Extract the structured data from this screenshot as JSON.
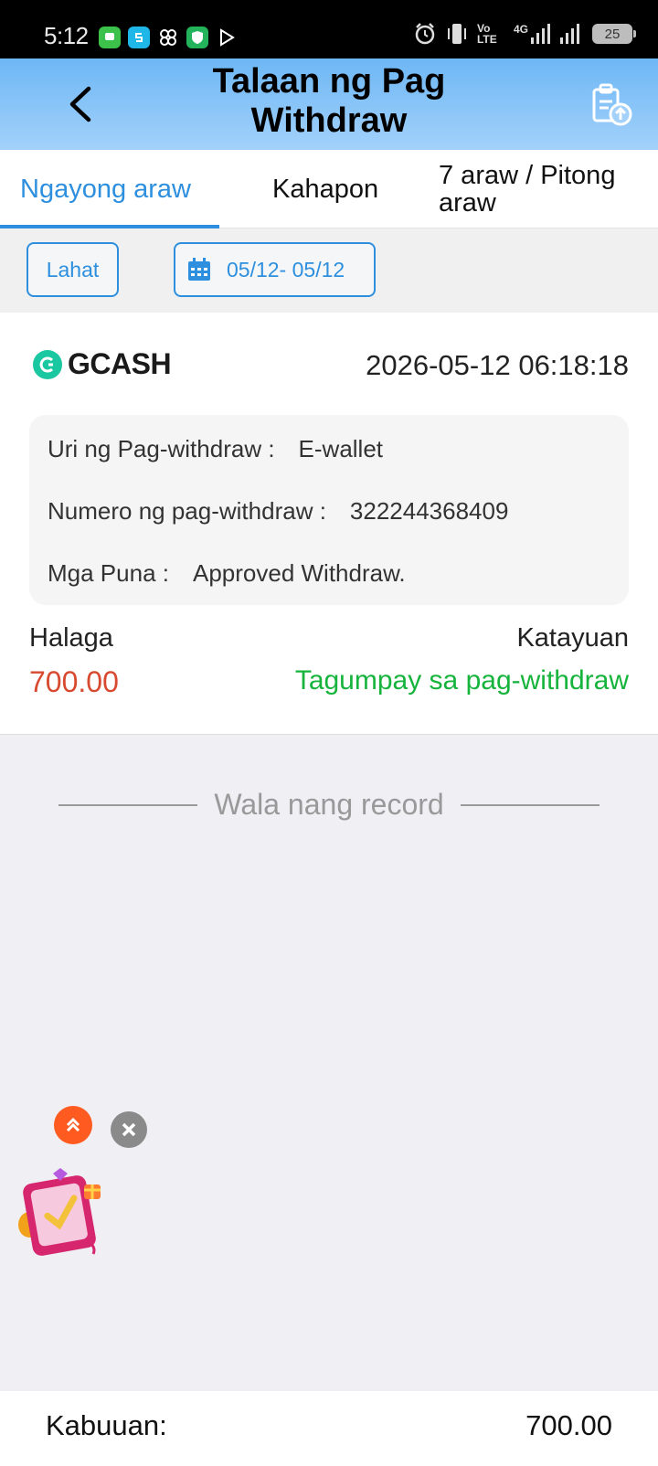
{
  "status_bar": {
    "time": "5:12",
    "battery": "25",
    "network": "4G",
    "volte": "Vo LTE"
  },
  "header": {
    "title": "Talaan ng Pag Withdraw",
    "back_icon": "chevron-left-icon",
    "report_icon": "clipboard-upload-icon"
  },
  "tabs": [
    {
      "label": "Ngayong araw",
      "active": true
    },
    {
      "label": "Kahapon",
      "active": false
    },
    {
      "label": "7 araw / Pitong araw",
      "active": false
    }
  ],
  "filters": {
    "all_label": "Lahat",
    "date_range": "05/12- 05/12"
  },
  "record": {
    "provider": "GCASH",
    "datetime": "2026-05-12 06:18:18",
    "type_label": "Uri ng Pag-withdraw :",
    "type_value": "E-wallet",
    "number_label": "Numero ng pag-withdraw :",
    "number_value": "322244368409",
    "remarks_label": "Mga Puna :",
    "remarks_value": "Approved Withdraw.",
    "amount_label": "Halaga",
    "amount_value": "700.00",
    "status_label": "Katayuan",
    "status_value": "Tagumpay sa pag-withdraw"
  },
  "no_more": "Wala nang record",
  "footer": {
    "total_label": "Kabuuan:",
    "total_value": "700.00"
  },
  "colors": {
    "accent": "#2d8fde",
    "amount": "#d84a2f",
    "success": "#16b43c",
    "header_top": "#6db7f5",
    "header_bottom": "#a3d1fa"
  }
}
